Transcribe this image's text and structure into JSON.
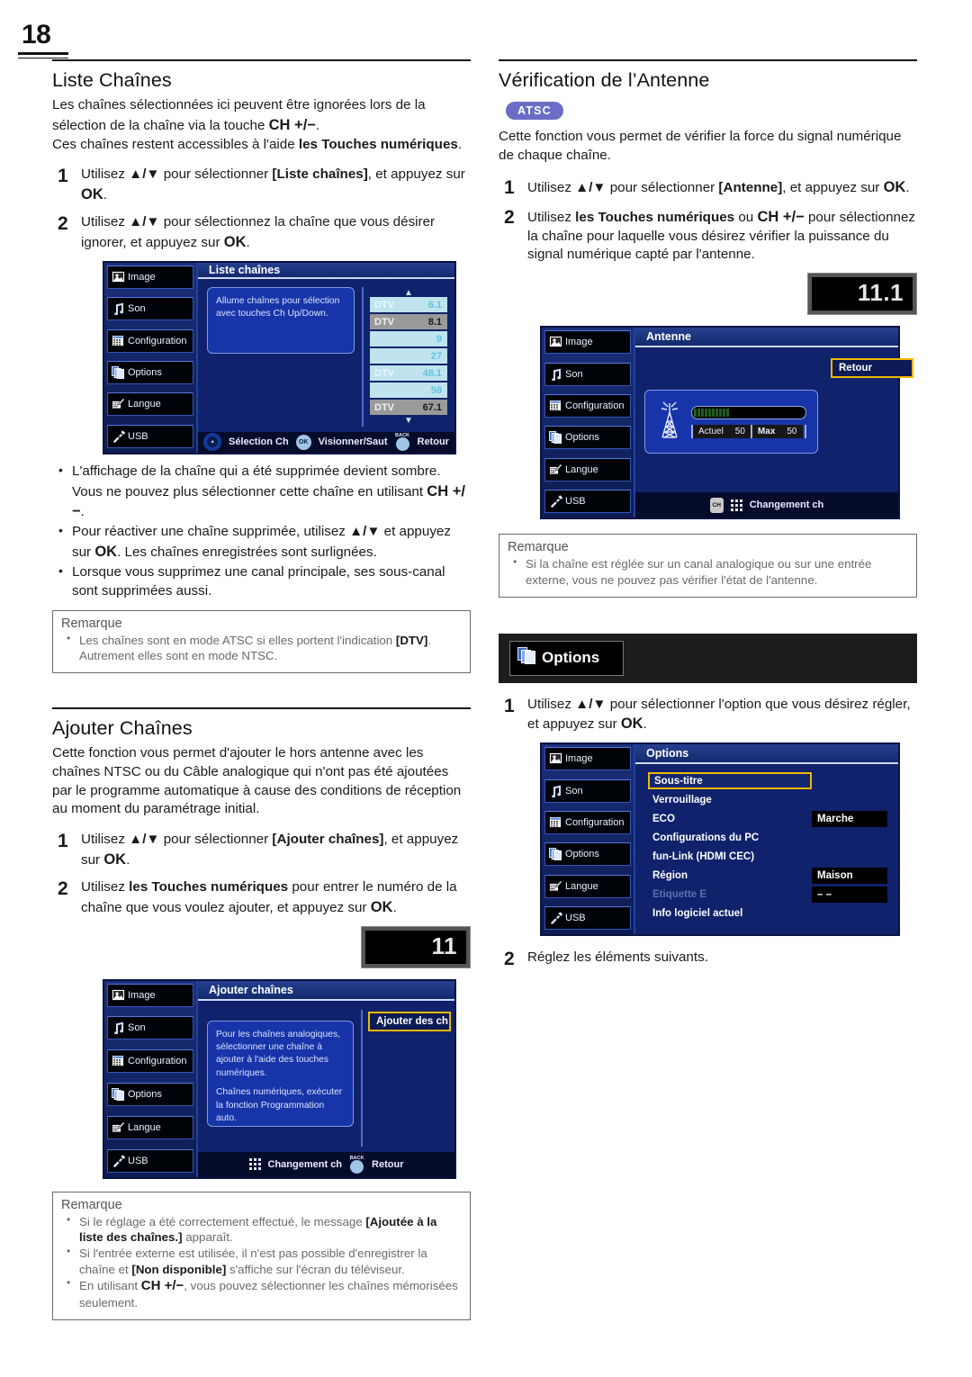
{
  "page": {
    "number": "18"
  },
  "left": {
    "section1": {
      "title": "Liste Chaînes",
      "intro_l1": "Les chaînes sélectionnées ici peuvent être ignorées lors de la",
      "intro_l2_a": "sélection de la chaîne via la touche ",
      "intro_l2_b": "CH +/−",
      "intro_l2_c": ".",
      "intro_l3_a": "Ces chaînes restent accessibles à l'aide ",
      "intro_l3_b": "les Touches numériques",
      "intro_l3_c": ".",
      "steps": [
        {
          "num": "1",
          "a": "Utilisez ",
          "arrows": "▲/▼",
          "b": " pour sélectionner ",
          "bold": "[Liste chaînes]",
          "c": ", et appuyez sur ",
          "bold2": "OK",
          "d": "."
        },
        {
          "num": "2",
          "a": "Utilisez ",
          "arrows": "▲/▼",
          "b": " pour sélectionnez la chaîne que vous désirer ignorer, et appuyez sur ",
          "bold2": "OK",
          "d": "."
        }
      ],
      "bullets": [
        {
          "a": "L'affichage de la chaîne qui a été supprimée devient sombre. Vous ne pouvez plus sélectionner cette chaîne en utilisant ",
          "bold": "CH +/−",
          "c": "."
        },
        {
          "a": "Pour réactiver une chaîne supprimée, utilisez ",
          "bold": "▲/▼",
          "c": " et appuyez sur ",
          "bold2": "OK",
          "d": ". Les chaînes enregistrées sont surlignées."
        },
        {
          "a": "Lorsque vous supprimez une canal principale, ses sous-canal sont supprimées aussi."
        }
      ],
      "remarque": {
        "title": "Remarque",
        "items": [
          {
            "a": "Les chaînes sont en mode ATSC si elles portent l'indication ",
            "bold": "[DTV]",
            "c": ". Autrement elles sont en mode NTSC."
          }
        ]
      }
    },
    "tv_liste": {
      "title": "Liste chaînes",
      "info_p1": "Allume chaînes pour sélection avec touches Ch Up/Down.",
      "sidebar": [
        {
          "label": "Image",
          "icon": "picture-icon"
        },
        {
          "label": "Son",
          "icon": "note-icon"
        },
        {
          "label": "Configuration",
          "icon": "grid-icon"
        },
        {
          "label": "Options",
          "icon": "pages-icon"
        },
        {
          "label": "Langue",
          "icon": "keyboard-pencil-icon"
        },
        {
          "label": "USB",
          "icon": "usb-icon"
        }
      ],
      "channels": [
        {
          "tag": "DTV",
          "num": "6.1",
          "style": "cyan"
        },
        {
          "tag": "DTV",
          "num": "8.1",
          "style": "grey"
        },
        {
          "tag": "",
          "num": "9",
          "style": "cyan"
        },
        {
          "tag": "",
          "num": "27",
          "style": "cyan"
        },
        {
          "tag": "DTV",
          "num": "48.1",
          "style": "cyan"
        },
        {
          "tag": "",
          "num": "58",
          "style": "cyan"
        },
        {
          "tag": "DTV",
          "num": "67.1",
          "style": "grey"
        }
      ],
      "footer": {
        "select_label": "Sélection Ch",
        "ok_label": "OK",
        "view_label": "Visionner/Saut",
        "back_label": "BACK",
        "return_label": "Retour"
      }
    },
    "section2": {
      "title": "Ajouter Chaînes",
      "intro": "Cette fonction vous permet d'ajouter le hors antenne avec les chaînes NTSC ou du Câble analogique qui n'ont pas été ajoutées par le programme automatique à cause des conditions de réception au moment du paramétrage initial.",
      "steps": [
        {
          "num": "1",
          "a": "Utilisez ",
          "arrows": "▲/▼",
          "b": " pour sélectionner ",
          "bold": "[Ajouter chaînes]",
          "c": ", et appuyez sur ",
          "bold2": "OK",
          "d": "."
        },
        {
          "num": "2",
          "a": "Utilisez ",
          "bold_lead": "les Touches numériques",
          "b": " pour entrer le numéro de la chaîne que vous voulez ajouter, et appuyez sur ",
          "bold2": "OK",
          "d": "."
        }
      ],
      "lcd_value": "11",
      "remarque": {
        "title": "Remarque",
        "items": [
          {
            "a": "Si le réglage a été correctement effectué, le message ",
            "bold": "[Ajoutée à la liste des chaînes.]",
            "c": " apparaît."
          },
          {
            "a": "Si l'entrée externe est utilisée, il n'est pas possible d'enregistrer la chaîne et ",
            "bold": "[Non disponible]",
            "c": " s'affiche sur l'écran du téléviseur."
          },
          {
            "a": "En utilisant ",
            "bold": "CH +/−",
            "c": ", vous pouvez sélectionner les chaînes mémorisées seulement."
          }
        ]
      }
    },
    "tv_ajouter": {
      "title": "Ajouter chaînes",
      "info_p1": "Pour les chaînes analogiques, sélectionner une chaîne à ajouter à l'aide des touches numériques.",
      "info_p2": "Chaînes numériques, exécuter la fonction Programmation auto.",
      "side_button": "Ajouter des ch",
      "sidebar": [
        {
          "label": "Image",
          "icon": "picture-icon"
        },
        {
          "label": "Son",
          "icon": "note-icon"
        },
        {
          "label": "Configuration",
          "icon": "grid-icon"
        },
        {
          "label": "Options",
          "icon": "pages-icon"
        },
        {
          "label": "Langue",
          "icon": "keyboard-pencil-icon"
        },
        {
          "label": "USB",
          "icon": "usb-icon"
        }
      ],
      "footer": {
        "change_label": "Changement ch",
        "back_label": "BACK",
        "return_label": "Retour"
      }
    }
  },
  "right": {
    "section1": {
      "title": "Vérification de l’Antenne",
      "badge": "ATSC",
      "intro": "Cette fonction vous permet de vérifier la force du signal numérique de chaque chaîne.",
      "steps": [
        {
          "num": "1",
          "a": "Utilisez ",
          "arrows": "▲/▼",
          "b": " pour sélectionner ",
          "bold": "[Antenne]",
          "c": ", et appuyez sur ",
          "bold2": "OK",
          "d": "."
        },
        {
          "num": "2",
          "a": "Utilisez ",
          "bold_lead": "les Touches numériques",
          "b2": " ou ",
          "bold3": "CH +/−",
          "b": " pour sélectionnez la chaîne pour laquelle vous désirez vérifier la puissance du signal numérique capté par l'antenne."
        }
      ],
      "lcd_value": "11.1",
      "remarque": {
        "title": "Remarque",
        "items": [
          {
            "a": "Si la chaîne est réglée sur un canal analogique ou sur une entrée externe, vous ne pouvez pas vérifier l'état de l'antenne."
          }
        ]
      }
    },
    "tv_antenne": {
      "title": "Antenne",
      "side_button": "Retour",
      "sidebar": [
        {
          "label": "Image",
          "icon": "picture-icon"
        },
        {
          "label": "Son",
          "icon": "note-icon"
        },
        {
          "label": "Configuration",
          "icon": "grid-icon"
        },
        {
          "label": "Options",
          "icon": "pages-icon"
        },
        {
          "label": "Langue",
          "icon": "keyboard-pencil-icon"
        },
        {
          "label": "USB",
          "icon": "usb-icon"
        }
      ],
      "signal": {
        "actuel_label": "Actuel",
        "actuel_value": "50",
        "max_label": "Max",
        "max_value": "50",
        "fill_percent": 50
      },
      "footer": {
        "ch_key": "CH",
        "change_label": "Changement ch"
      }
    },
    "options_banner": {
      "label": "Options",
      "icon": "pages-icon"
    },
    "section2": {
      "steps": [
        {
          "num": "1",
          "a": "Utilisez ",
          "arrows": "▲/▼",
          "b": " pour sélectionner l'option que vous désirez régler, et appuyez sur ",
          "bold2": "OK",
          "d": "."
        },
        {
          "num": "2",
          "a": "Réglez les éléments suivants."
        }
      ]
    },
    "tv_options": {
      "title": "Options",
      "sidebar": [
        {
          "label": "Image",
          "icon": "picture-icon"
        },
        {
          "label": "Son",
          "icon": "note-icon"
        },
        {
          "label": "Configuration",
          "icon": "grid-icon"
        },
        {
          "label": "Options",
          "icon": "pages-icon"
        },
        {
          "label": "Langue",
          "icon": "keyboard-pencil-icon"
        },
        {
          "label": "USB",
          "icon": "usb-icon"
        }
      ],
      "rows": [
        {
          "name": "Sous-titre",
          "value": "",
          "state": "selected"
        },
        {
          "name": "Verrouillage",
          "value": "",
          "state": "normal"
        },
        {
          "name": "ECO",
          "value": "Marche",
          "state": "normal"
        },
        {
          "name": "Configurations du PC",
          "value": "",
          "state": "normal"
        },
        {
          "name": "fun-Link (HDMI CEC)",
          "value": "",
          "state": "normal"
        },
        {
          "name": "Région",
          "value": "Maison",
          "state": "normal"
        },
        {
          "name": "Etiquette E",
          "value": "– –",
          "state": "dim"
        },
        {
          "name": "Info logiciel actuel",
          "value": "",
          "state": "normal"
        }
      ]
    }
  },
  "colors": {
    "atsc_badge": "#6a6ec6",
    "osd_blue": "#10226b",
    "osd_highlight": "#f0b800",
    "channel_cyan": "#bfe4ef",
    "channel_grey": "#9a9a9a"
  }
}
